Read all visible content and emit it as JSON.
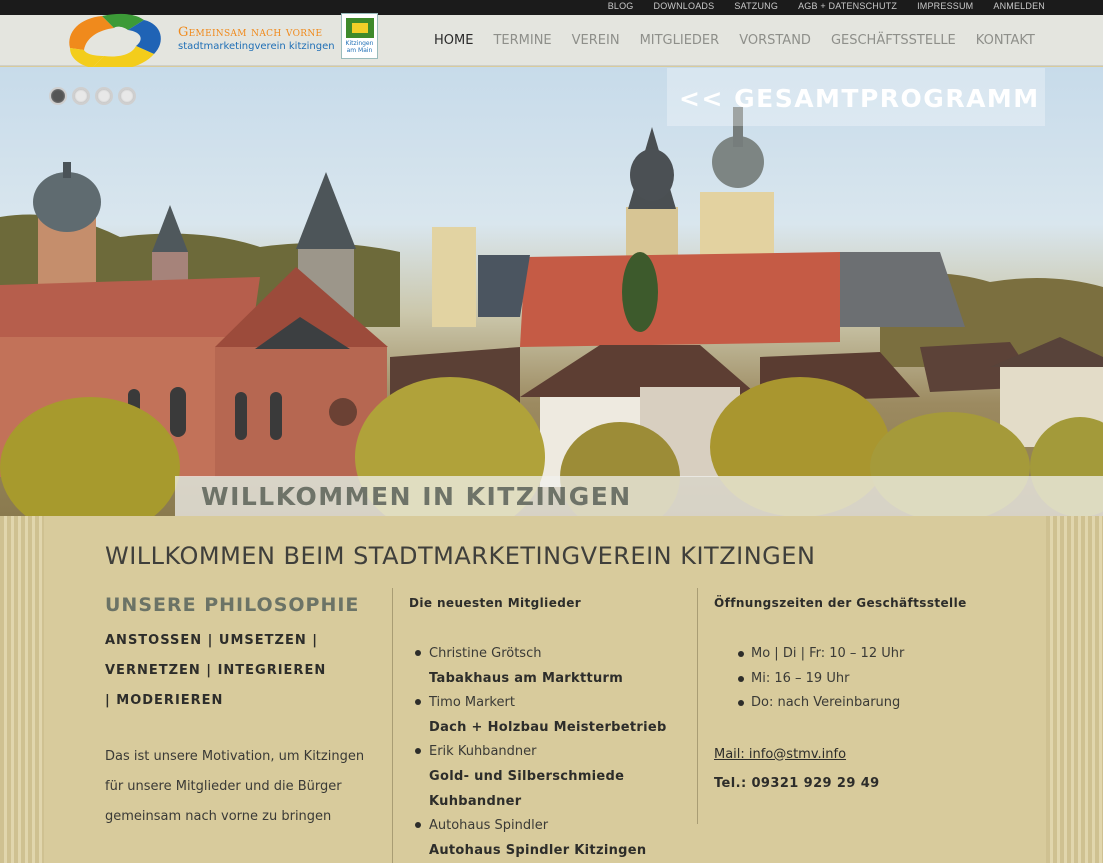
{
  "topbar": {
    "links": [
      "BLOG",
      "DOWNLOADS",
      "SATZUNG",
      "AGB + DATENSCHUTZ",
      "IMPRESSUM",
      "ANMELDEN"
    ]
  },
  "brand": {
    "line1": "Gemeinsam nach vorne",
    "line2": "stadtmarketingverein kitzingen",
    "badge_text": "Kitzingen am Main"
  },
  "nav": {
    "items": [
      "HOME",
      "TERMINE",
      "VEREIN",
      "MITGLIEDER",
      "VORSTAND",
      "GESCHÄFTSSTELLE",
      "KONTAKT"
    ],
    "active": "HOME"
  },
  "hero": {
    "slides_count": 4,
    "active_slide": 1,
    "program_link": "<< GESAMTPROGRAMM",
    "welcome": "WILLKOMMEN IN KITZINGEN"
  },
  "main": {
    "title": "WILLKOMMEN BEIM STADTMARKETINGVEREIN KITZINGEN",
    "philosophy": {
      "heading": "UNSERE PHILOSOPHIE",
      "motto": "ANSTOSSEN | UMSETZEN | VERNETZEN | INTEGRIEREN | MODERIEREN",
      "motivation": "Das ist unsere Motivation, um Kitzingen für unsere Mitglieder und die Bürger gemeinsam nach vorne zu bringen"
    },
    "members": {
      "heading": "Die neuesten Mitglieder",
      "items": [
        {
          "name": "Christine Grötsch",
          "company": "Tabakhaus am Marktturm"
        },
        {
          "name": "Timo Markert",
          "company": "Dach + Holzbau Meisterbetrieb"
        },
        {
          "name": "Erik Kuhbandner",
          "company": "Gold- und Silberschmiede Kuhbandner"
        },
        {
          "name": "Autohaus Spindler",
          "company": "Autohaus Spindler Kitzingen"
        }
      ]
    },
    "hours": {
      "heading": "Öffnungszeiten der Geschäftsstelle",
      "items": [
        "Mo | Di | Fr: 10 – 12 Uhr",
        "Mi: 16 – 19 Uhr",
        "Do: nach Vereinbarung"
      ],
      "email": "Mail: info@stmv.info",
      "phone": "Tel.: 09321 929 29 49"
    }
  },
  "colors": {
    "topbar": "#1b1b1b",
    "header": "#e4e5df",
    "content_bg": "#d8cb9c",
    "brand_orange": "#f08a1c",
    "brand_blue": "#1f6fb6"
  }
}
